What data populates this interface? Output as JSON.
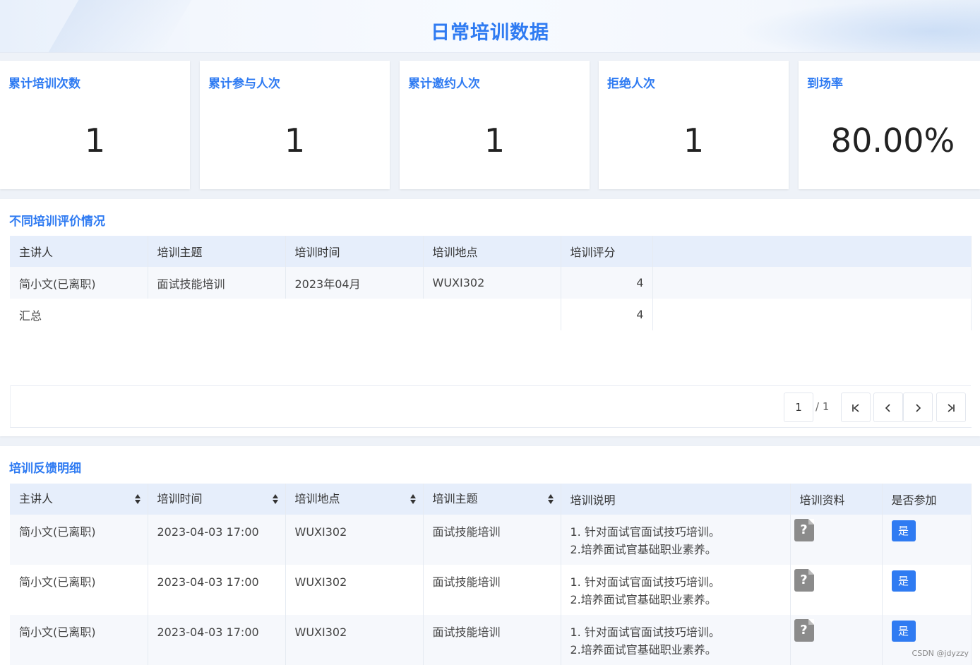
{
  "header": {
    "title": "日常培训数据"
  },
  "stats": [
    {
      "label": "累计培训次数",
      "value": "1"
    },
    {
      "label": "累计参与人次",
      "value": "1"
    },
    {
      "label": "累计邀约人次",
      "value": "1"
    },
    {
      "label": "拒绝人次",
      "value": "1"
    },
    {
      "label": "到场率",
      "value": "80.00%"
    }
  ],
  "evaluation": {
    "title": "不同培训评价情况",
    "columns": [
      "主讲人",
      "培训主题",
      "培训时间",
      "培训地点",
      "培训评分"
    ],
    "rows": [
      {
        "speaker": "简小文(已离职)",
        "topic": "面试技能培训",
        "time": "2023年04月",
        "location": "WUXI302",
        "score": "4"
      }
    ],
    "summary": {
      "label": "汇总",
      "score": "4"
    },
    "pager": {
      "current": "1",
      "total": "/ 1"
    }
  },
  "feedback": {
    "title": "培训反馈明细",
    "columns": [
      "主讲人",
      "培训时间",
      "培训地点",
      "培训主题",
      "培训说明",
      "培训资料",
      "是否参加"
    ],
    "rows": [
      {
        "speaker": "简小文(已离职)",
        "time": "2023-04-03 17:00",
        "location": "WUXI302",
        "topic": "面试技能培训",
        "desc1": "1. 针对面试官面试技巧培训。",
        "desc2": "2.培养面试官基础职业素养。",
        "file_icon": "?",
        "attend": "是"
      },
      {
        "speaker": "简小文(已离职)",
        "time": "2023-04-03 17:00",
        "location": "WUXI302",
        "topic": "面试技能培训",
        "desc1": "1. 针对面试官面试技巧培训。",
        "desc2": "2.培养面试官基础职业素养。",
        "file_icon": "?",
        "attend": "是"
      },
      {
        "speaker": "简小文(已离职)",
        "time": "2023-04-03 17:00",
        "location": "WUXI302",
        "topic": "面试技能培训",
        "desc1": "1. 针对面试官面试技巧培训。",
        "desc2": "2.培养面试官基础职业素养。",
        "file_icon": "?",
        "attend": "是"
      }
    ]
  },
  "watermark": "CSDN @jdyzzy",
  "colors": {
    "accent": "#2f7bf2",
    "header_bg": "#e6eefb",
    "file_icon": "#8b8b8b"
  }
}
